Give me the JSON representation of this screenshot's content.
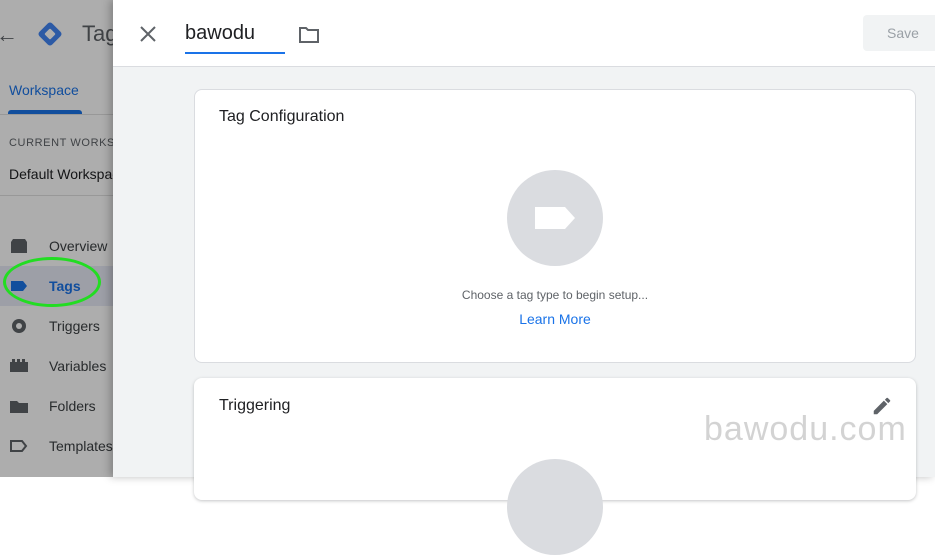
{
  "background_app": {
    "product_name": "Tag",
    "tabs": [
      {
        "label": "Workspace"
      }
    ],
    "workspace_section": {
      "label": "CURRENT WORKSPACE",
      "value": "Default Workspace"
    },
    "nav_items": [
      {
        "label": "Overview",
        "icon": "overview-icon"
      },
      {
        "label": "Tags",
        "icon": "tag-icon",
        "active": true
      },
      {
        "label": "Triggers",
        "icon": "trigger-icon"
      },
      {
        "label": "Variables",
        "icon": "variables-icon"
      },
      {
        "label": "Folders",
        "icon": "folder-icon"
      },
      {
        "label": "Templates",
        "icon": "template-icon"
      }
    ]
  },
  "editor": {
    "tag_name": "bawodu",
    "save_label": "Save",
    "config_card": {
      "title": "Tag Configuration",
      "hint": "Choose a tag type to begin setup...",
      "link": "Learn More"
    },
    "trigger_card": {
      "title": "Triggering"
    }
  },
  "watermark": "bawodu.com",
  "colors": {
    "accent": "#1a73e8",
    "annotation": "#22dd22",
    "placeholder": "#dadce0"
  }
}
